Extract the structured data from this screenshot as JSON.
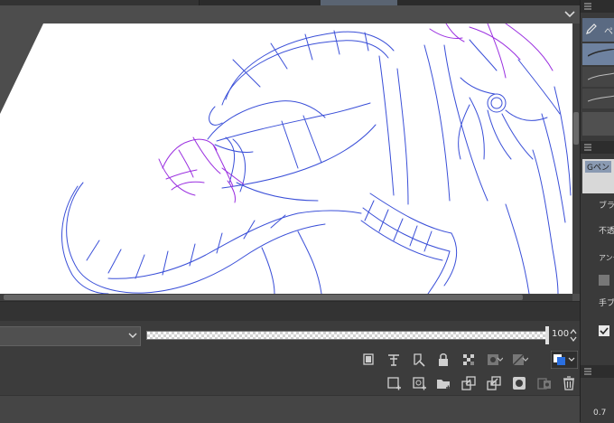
{
  "layer": {
    "blend_mode": "",
    "opacity": "100"
  },
  "sub_tool": {
    "tab_label": "ペ",
    "selected_brush": "Gペン"
  },
  "tool_property": {
    "brush_size_label": "ブラシ",
    "opacity_label": "不透",
    "antialias_label": "アンチ",
    "hand_shake_label": "手ブ",
    "hand_shake_value": "0.7"
  },
  "icons": {
    "row1": [
      "clip-to-layer-below-icon",
      "reference-layer-icon",
      "draft-layer-icon",
      "lock-layer-icon",
      "lock-transparent-pixels-icon",
      "mask-enable-icon",
      "ruler-display-icon",
      "layer-color-icon"
    ],
    "row2": [
      "new-raster-layer-icon",
      "new-vector-layer-icon",
      "new-folder-icon",
      "transfer-to-layer-below-icon",
      "combine-to-layer-below-icon",
      "create-layer-mask-icon",
      "apply-mask-icon",
      "delete-layer-icon"
    ]
  },
  "colors": {
    "sketch_blue": "#3a4fd8",
    "sketch_purple": "#9a2ee0",
    "layer_color_blue": "#2a6fe0",
    "panel_dark": "#3c3c3c"
  }
}
